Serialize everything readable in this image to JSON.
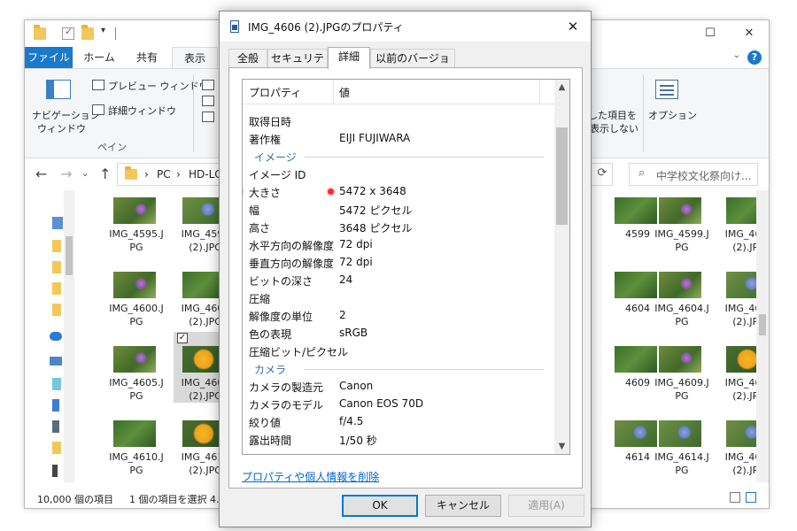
{
  "explorer": {
    "tabs": {
      "file": "ファイル",
      "home": "ホーム",
      "share": "共有",
      "view": "表示"
    },
    "ribbon": {
      "nav_pane_line1": "ナビゲーション",
      "nav_pane_line2": "ウィンドウ",
      "preview_pane": "プレビュー ウィンドウ",
      "details_pane": "詳細ウィンドウ",
      "group_panes": "ペイン",
      "hide_selected_line1": "した項目を",
      "hide_selected_line2": "表示しない",
      "options": "オプション"
    },
    "address": {
      "pc": "PC",
      "drive": "HD-LCU"
    },
    "search_placeholder": "中学校文化祭向け...",
    "thumbnails": [
      {
        "line1": "IMG_4595.J",
        "line2": "PG",
        "kind": "purple"
      },
      {
        "line1": "IMG_4596",
        "line2": "(2).JPG",
        "kind": "blue"
      },
      {
        "line1": "4599",
        "line2": "",
        "kind": "green"
      },
      {
        "line1": "IMG_4599.J",
        "line2": "PG",
        "kind": "purple"
      },
      {
        "line1": "IMG_4600",
        "line2": "(2).JPG",
        "kind": "green"
      },
      {
        "line1": "IMG_4600.J",
        "line2": "PG",
        "kind": "purple"
      },
      {
        "line1": "IMG_4601",
        "line2": "(2).JPG",
        "kind": "green"
      },
      {
        "line1": "4604",
        "line2": "",
        "kind": "green"
      },
      {
        "line1": "IMG_4604.J",
        "line2": "PG",
        "kind": "purple"
      },
      {
        "line1": "IMG_4605",
        "line2": "(2).JPG",
        "kind": "blue"
      },
      {
        "line1": "IMG_4605.J",
        "line2": "PG",
        "kind": "purple"
      },
      {
        "line1": "IMG_4606",
        "line2": "(2).JPG",
        "kind": "yellow"
      },
      {
        "line1": "4609",
        "line2": "",
        "kind": "green"
      },
      {
        "line1": "IMG_4609.J",
        "line2": "PG",
        "kind": "purple"
      },
      {
        "line1": "IMG_4610",
        "line2": "(2).JPG",
        "kind": "yellow"
      },
      {
        "line1": "IMG_4610.J",
        "line2": "PG",
        "kind": "green"
      },
      {
        "line1": "IMG_4611",
        "line2": "(2).JPG",
        "kind": "yellow"
      },
      {
        "line1": "4614",
        "line2": "",
        "kind": "blue"
      },
      {
        "line1": "IMG_4614.J",
        "line2": "PG",
        "kind": "blue"
      },
      {
        "line1": "IMG_4615",
        "line2": "(2).JPG",
        "kind": "blue"
      }
    ],
    "status": {
      "count": "10,000 個の項目",
      "selected": "1 個の項目を選択 4."
    }
  },
  "dialog": {
    "title": "IMG_4606 (2).JPGのプロパティ",
    "tabs": {
      "general": "全般",
      "security": "セキュリティ",
      "details": "詳細",
      "previous": "以前のバージョン"
    },
    "header": {
      "property": "プロパティ",
      "value": "値"
    },
    "rows": [
      {
        "type": "prop",
        "name": "取得日時",
        "value": ""
      },
      {
        "type": "prop",
        "name": "著作権",
        "value": "EIJI FUJIWARA"
      },
      {
        "type": "section",
        "name": "イメージ"
      },
      {
        "type": "prop",
        "name": "イメージ ID",
        "value": ""
      },
      {
        "type": "prop",
        "name": "大きさ",
        "value": "5472 x 3648",
        "highlight": true
      },
      {
        "type": "prop",
        "name": "幅",
        "value": "5472 ピクセル"
      },
      {
        "type": "prop",
        "name": "高さ",
        "value": "3648 ピクセル"
      },
      {
        "type": "prop",
        "name": "水平方向の解像度",
        "value": "72 dpi"
      },
      {
        "type": "prop",
        "name": "垂直方向の解像度",
        "value": "72 dpi"
      },
      {
        "type": "prop",
        "name": "ビットの深さ",
        "value": "24"
      },
      {
        "type": "prop",
        "name": "圧縮",
        "value": ""
      },
      {
        "type": "prop",
        "name": "解像度の単位",
        "value": "2"
      },
      {
        "type": "prop",
        "name": "色の表現",
        "value": "sRGB"
      },
      {
        "type": "prop",
        "name": "圧縮ビット/ピクセル",
        "value": ""
      },
      {
        "type": "section",
        "name": "カメラ"
      },
      {
        "type": "prop",
        "name": "カメラの製造元",
        "value": "Canon"
      },
      {
        "type": "prop",
        "name": "カメラのモデル",
        "value": "Canon EOS 70D"
      },
      {
        "type": "prop",
        "name": "絞り値",
        "value": "f/4.5"
      },
      {
        "type": "prop",
        "name": "露出時間",
        "value": "1/50 秒"
      }
    ],
    "remove_link": "プロパティや個人情報を削除",
    "buttons": {
      "ok": "OK",
      "cancel": "キャンセル",
      "apply": "適用(A)"
    }
  }
}
